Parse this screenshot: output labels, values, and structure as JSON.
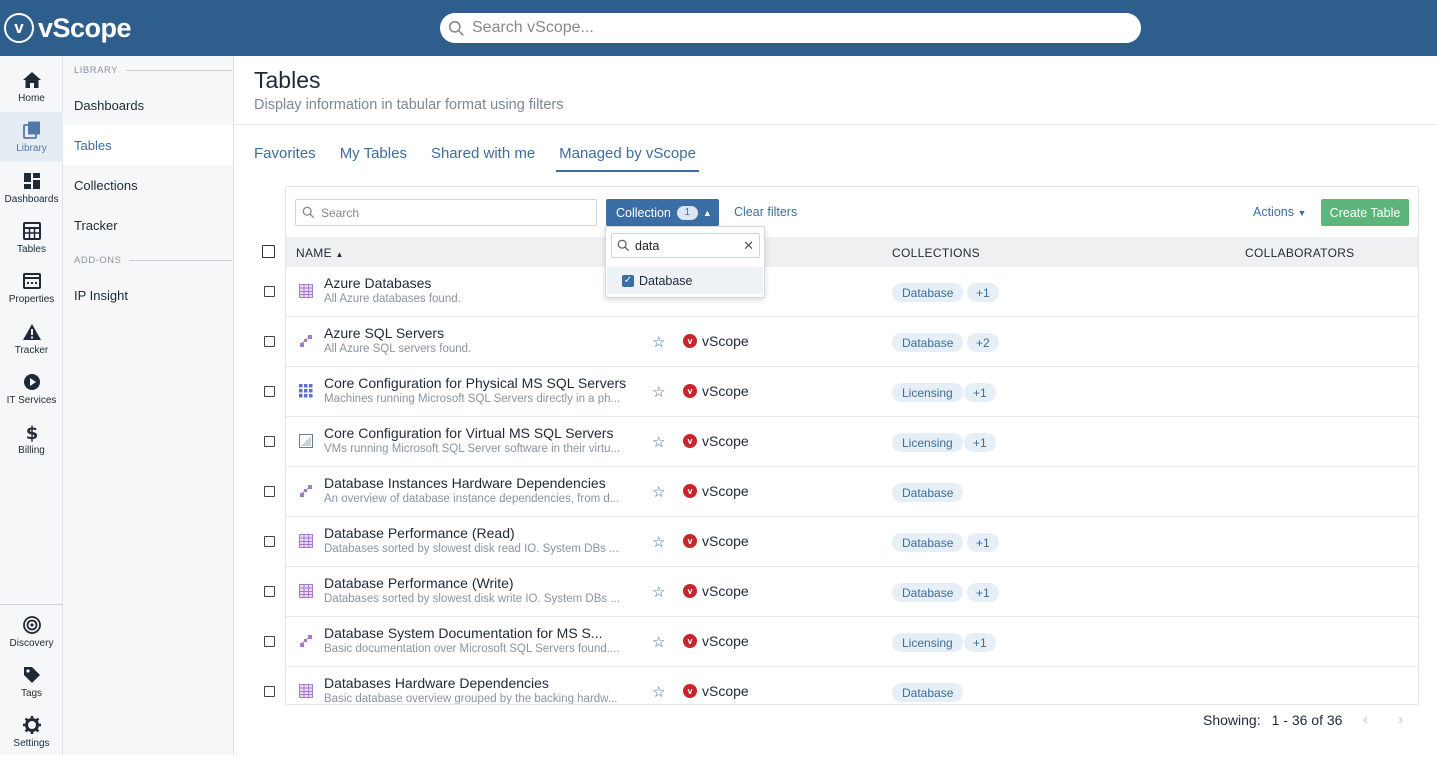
{
  "app": {
    "logo_text": "vScope",
    "logo_mark": "v"
  },
  "global_search": {
    "placeholder": "Search vScope..."
  },
  "rail": {
    "items": [
      {
        "label": "Home",
        "icon": "home-icon"
      },
      {
        "label": "Library",
        "icon": "library-icon",
        "active": true
      },
      {
        "label": "Dashboards",
        "icon": "dashboards-icon"
      },
      {
        "label": "Tables",
        "icon": "tables-icon"
      },
      {
        "label": "Properties",
        "icon": "properties-icon"
      },
      {
        "label": "Tracker",
        "icon": "tracker-icon"
      },
      {
        "label": "IT Services",
        "icon": "it-services-icon"
      },
      {
        "label": "Billing",
        "icon": "billing-icon"
      }
    ],
    "bottom": [
      {
        "label": "Discovery",
        "icon": "discovery-icon"
      },
      {
        "label": "Tags",
        "icon": "tags-icon"
      },
      {
        "label": "Settings",
        "icon": "settings-icon"
      }
    ]
  },
  "nav2": {
    "library_header": "LIBRARY",
    "items": [
      "Dashboards",
      "Tables",
      "Collections",
      "Tracker"
    ],
    "active": "Tables",
    "addons_header": "ADD-ONS",
    "addons": [
      "IP Insight"
    ]
  },
  "page": {
    "title": "Tables",
    "subtitle": "Display information in tabular format using filters"
  },
  "tabs": [
    "Favorites",
    "My Tables",
    "Shared with me",
    "Managed by vScope"
  ],
  "active_tab": "Managed by vScope",
  "toolbar": {
    "search_placeholder": "Search",
    "collection_label": "Collection",
    "collection_count": "1",
    "clear_filters": "Clear filters",
    "actions": "Actions",
    "create_table": "Create Table"
  },
  "table": {
    "headers": {
      "name": "NAME",
      "collections": "COLLECTIONS",
      "collaborators": "COLLABORATORS"
    },
    "rows": [
      {
        "icon": "table-grid-icon",
        "name": "Azure Databases",
        "desc": "All Azure databases found.",
        "owner": "",
        "chips": [
          "Database",
          "+1"
        ]
      },
      {
        "icon": "dependency-icon",
        "name": "Azure SQL Servers",
        "desc": "All Azure SQL servers found.",
        "owner": "vScope",
        "chips": [
          "Database",
          "+2"
        ]
      },
      {
        "icon": "matrix-icon",
        "name": "Core Configuration for Physical MS SQL Servers",
        "desc": "Machines running Microsoft SQL Servers directly in a ph...",
        "owner": "vScope",
        "chips": [
          "Licensing",
          "+1"
        ]
      },
      {
        "icon": "virtual-icon",
        "name": "Core Configuration for Virtual MS SQL Servers",
        "desc": "VMs running Microsoft SQL Server software in their virtu...",
        "owner": "vScope",
        "chips": [
          "Licensing",
          "+1"
        ]
      },
      {
        "icon": "dependency-icon",
        "name": "Database Instances Hardware Dependencies",
        "desc": "An overview of database instance dependencies, from d...",
        "owner": "vScope",
        "chips": [
          "Database"
        ]
      },
      {
        "icon": "table-grid-icon",
        "name": "Database Performance (Read)",
        "desc": "Databases sorted by slowest disk read IO. System DBs ...",
        "owner": "vScope",
        "chips": [
          "Database",
          "+1"
        ]
      },
      {
        "icon": "table-grid-icon",
        "name": "Database Performance (Write)",
        "desc": "Databases sorted by slowest disk write IO. System DBs ...",
        "owner": "vScope",
        "chips": [
          "Database",
          "+1"
        ]
      },
      {
        "icon": "dependency-icon",
        "name": "Database System Documentation for MS S...",
        "desc": "Basic documentation over Microsoft SQL Servers found....",
        "owner": "vScope",
        "chips": [
          "Licensing",
          "+1"
        ]
      },
      {
        "icon": "table-grid-icon",
        "name": "Databases Hardware Dependencies",
        "desc": "Basic database overview grouped by the backing hardw...",
        "owner": "vScope",
        "chips": [
          "Database"
        ]
      }
    ]
  },
  "dropdown": {
    "query": "data",
    "option": "Database",
    "option_checked": true
  },
  "footer": {
    "showing_label": "Showing:",
    "range": "1 - 36 of 36"
  },
  "colors": {
    "topbar": "#2e5f8c",
    "accent": "#3d6d9c",
    "create": "#5cb57a",
    "owner_logo": "#c8252c"
  }
}
